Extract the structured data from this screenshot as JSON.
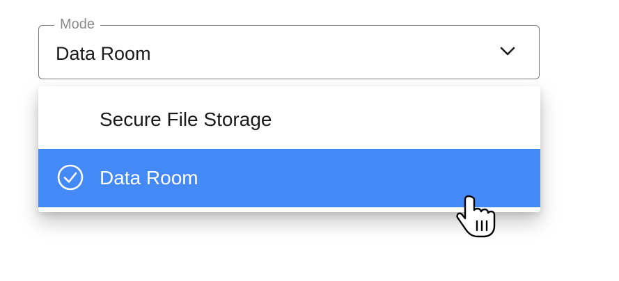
{
  "select": {
    "label": "Mode",
    "value": "Data Room",
    "icon": "chevron-down-icon"
  },
  "menu": {
    "items": [
      {
        "label": "Secure File Storage",
        "selected": false
      },
      {
        "label": "Data Room",
        "selected": true,
        "icon": "check-circle-icon"
      }
    ]
  },
  "colors": {
    "selected_bg": "#448af7",
    "selected_text": "#ffffff",
    "text": "#1a1a1a",
    "border": "#7a7a7a",
    "label": "#8a8a8a"
  },
  "cursor": {
    "icon": "hand-pointer-icon"
  }
}
